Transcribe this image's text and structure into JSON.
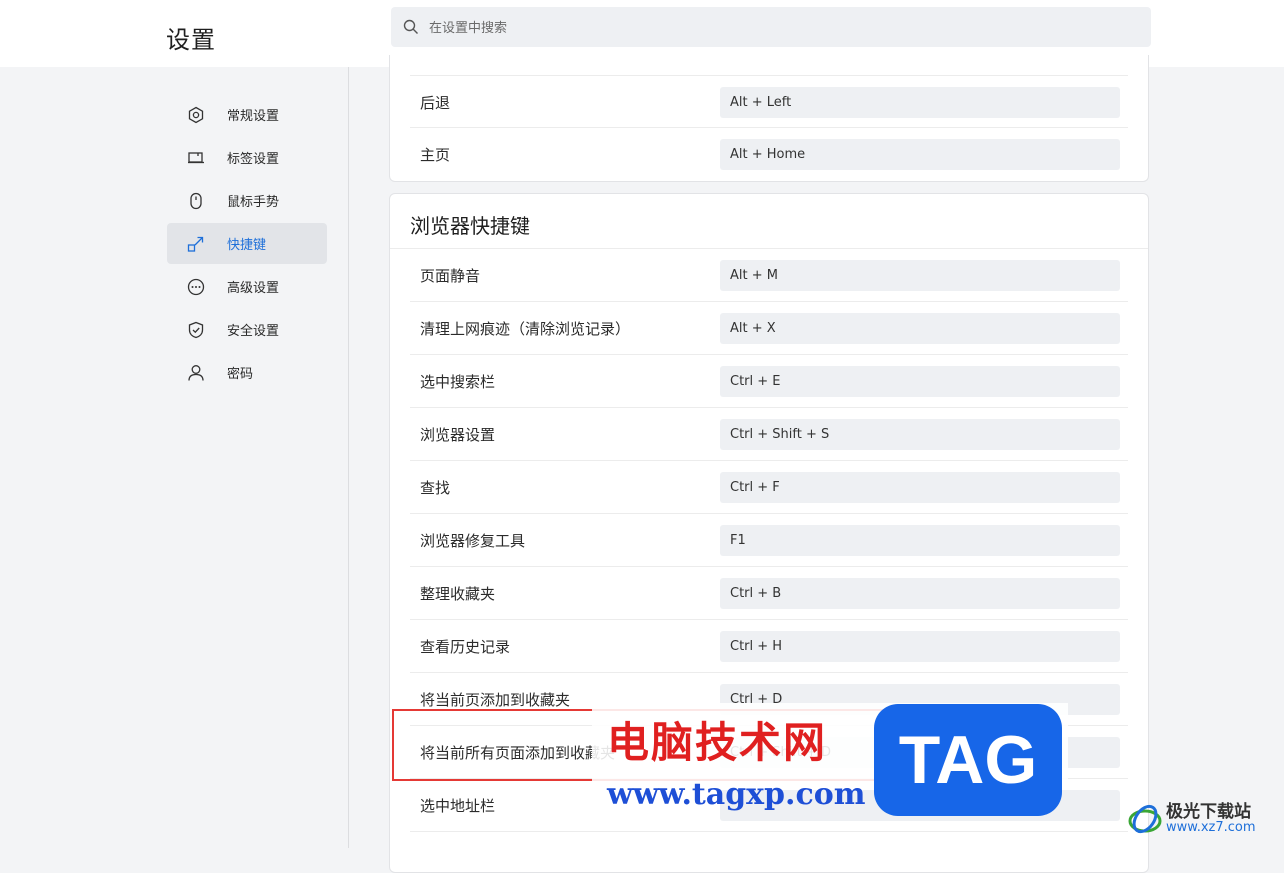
{
  "header": {
    "title": "设置",
    "search_placeholder": "在设置中搜索"
  },
  "sidebar": {
    "items": [
      {
        "label": "常规设置",
        "icon": "hexagon-settings-icon"
      },
      {
        "label": "标签设置",
        "icon": "tab-icon"
      },
      {
        "label": "鼠标手势",
        "icon": "mouse-icon"
      },
      {
        "label": "快捷键",
        "icon": "shortcut-arrow-icon",
        "active": true
      },
      {
        "label": "高级设置",
        "icon": "more-dots-icon"
      },
      {
        "label": "安全设置",
        "icon": "shield-check-icon"
      },
      {
        "label": "密码",
        "icon": "person-icon"
      }
    ]
  },
  "nav_shortcuts": {
    "rows": [
      {
        "label": "后退",
        "key": "Alt + Left"
      },
      {
        "label": "主页",
        "key": "Alt + Home"
      }
    ]
  },
  "browser_shortcuts": {
    "heading": "浏览器快捷键",
    "rows": [
      {
        "label": "页面静音",
        "key": "Alt + M"
      },
      {
        "label": "清理上网痕迹（清除浏览记录）",
        "key": "Alt + X"
      },
      {
        "label": "选中搜索栏",
        "key": "Ctrl + E"
      },
      {
        "label": "浏览器设置",
        "key": "Ctrl + Shift + S"
      },
      {
        "label": "查找",
        "key": "Ctrl + F"
      },
      {
        "label": "浏览器修复工具",
        "key": "F1"
      },
      {
        "label": "整理收藏夹",
        "key": "Ctrl + B"
      },
      {
        "label": "查看历史记录",
        "key": "Ctrl + H"
      },
      {
        "label": "将当前页添加到收藏夹",
        "key": "Ctrl + D"
      },
      {
        "label": "将当前所有页面添加到收藏夹",
        "key": "Ctrl + Shift + D"
      },
      {
        "label": "选中地址栏",
        "key": ""
      }
    ]
  },
  "watermark": {
    "title": "电脑技术网",
    "url": "www.tagxp.com",
    "badge": "TAG",
    "site_name": "极光下载站",
    "site_url": "www.xz7.com"
  },
  "colors": {
    "accent": "#1e6fd9",
    "active_bg": "#e2e4e8",
    "key_bg": "#eef0f3",
    "page_bg": "#f3f4f6"
  }
}
